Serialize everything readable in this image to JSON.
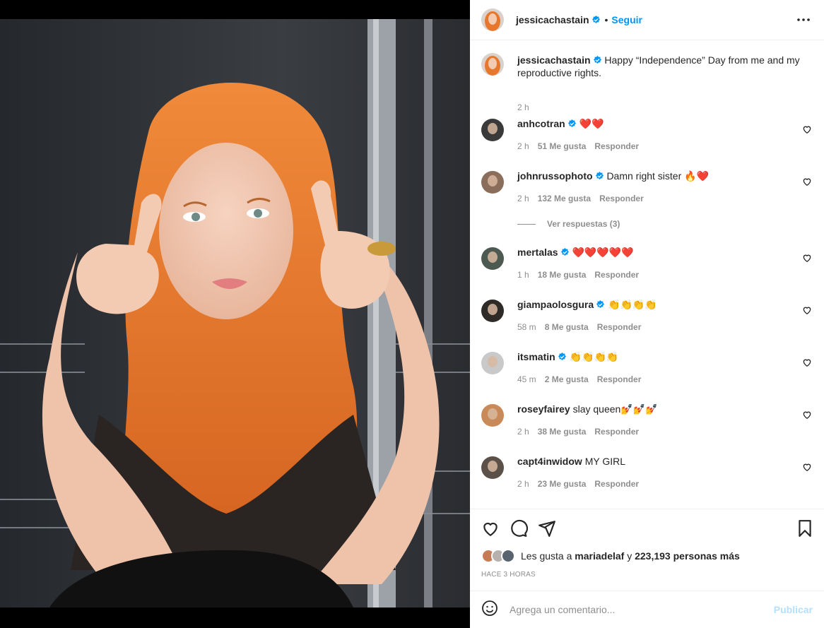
{
  "post": {
    "username": "jessicachastain",
    "follow_label": "Seguir",
    "caption": "Happy “Independence” Day from me and my reproductive rights.",
    "caption_time": "2 h"
  },
  "comments": [
    {
      "user": "anhcotran",
      "text": "❤️❤️",
      "time": "2 h",
      "likes": "51 Me gusta",
      "reply": "Responder",
      "verified": true
    },
    {
      "user": "johnrussophoto",
      "text": "Damn right sister 🔥❤️",
      "time": "2 h",
      "likes": "132 Me gusta",
      "reply": "Responder",
      "verified": true
    },
    {
      "user": "mertalas",
      "text": "❤️❤️❤️❤️❤️",
      "time": "1 h",
      "likes": "18 Me gusta",
      "reply": "Responder",
      "verified": true
    },
    {
      "user": "giampaolosgura",
      "text": "👏👏👏👏",
      "time": "58 m",
      "likes": "8 Me gusta",
      "reply": "Responder",
      "verified": true
    },
    {
      "user": "itsmatin",
      "text": "👏👏👏👏",
      "time": "45 m",
      "likes": "2 Me gusta",
      "reply": "Responder",
      "verified": true
    },
    {
      "user": "roseyfairey",
      "text": "slay queen💅💅💅",
      "time": "2 h",
      "likes": "38 Me gusta",
      "reply": "Responder",
      "verified": false
    },
    {
      "user": "capt4inwidow",
      "text": "MY GIRL",
      "time": "2 h",
      "likes": "23 Me gusta",
      "reply": "Responder",
      "verified": false
    }
  ],
  "view_replies": "Ver respuestas (3)",
  "likes": {
    "prefix": "Les gusta a",
    "user": "mariadelaf",
    "connector": "y",
    "others": "223,193 personas más"
  },
  "time_ago": "HACE 3 HORAS",
  "add_comment": {
    "placeholder": "Agrega un comentario...",
    "publish": "Publicar"
  },
  "colors": {
    "accent": "#0095f6",
    "publish_disabled": "#b2dffc",
    "muted": "#8e8e8e",
    "hair": "#e8772e"
  }
}
